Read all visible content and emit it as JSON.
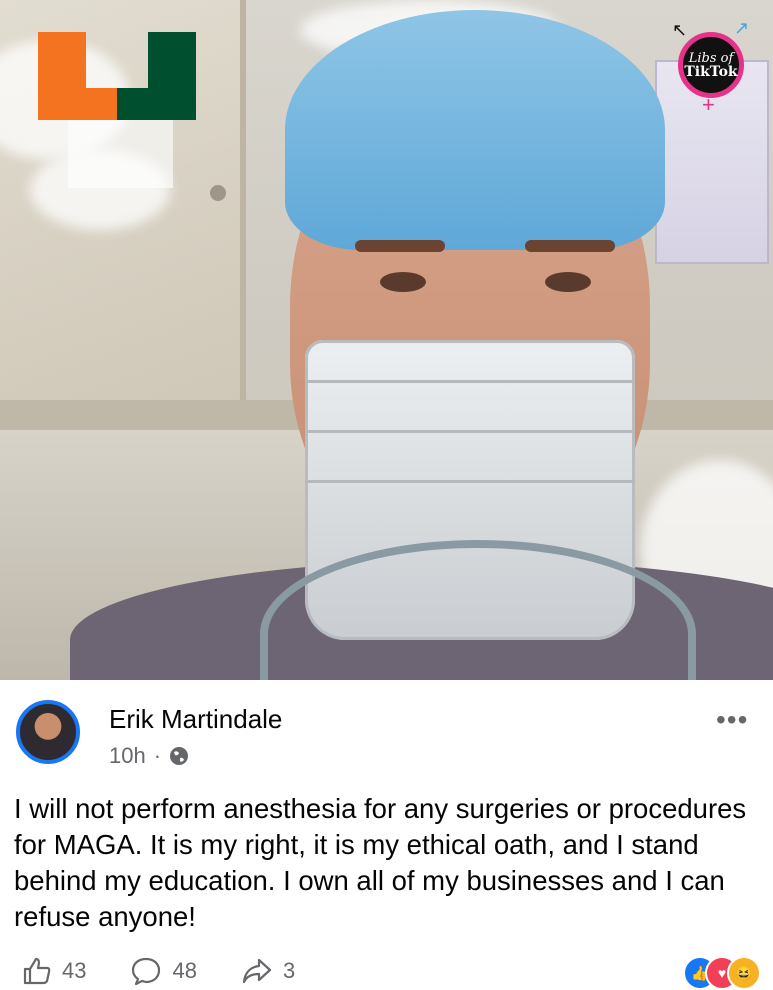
{
  "photo": {
    "overlay_logo_left": {
      "name": "university-u-logo",
      "colors": [
        "#f47321",
        "#005030"
      ]
    },
    "overlay_badge_right": {
      "line1": "Libs of",
      "line2": "TikTok",
      "accent": "#e6338a"
    }
  },
  "post": {
    "author": "Erik Martindale",
    "time": "10h",
    "separator": "·",
    "privacy_icon": "globe-icon",
    "more_icon": "•••",
    "text": "I will not perform anesthesia for any surgeries or procedures for MAGA. It is my right, it is my ethical oath, and I stand behind my education. I own all of my businesses and I can refuse anyone!",
    "actions": {
      "likes": "43",
      "comments": "48",
      "shares": "3"
    },
    "reactions": [
      "like-reaction",
      "love-reaction",
      "haha-reaction"
    ],
    "colors": {
      "accent": "#1877f2",
      "meta": "#65676b",
      "text": "#050505"
    }
  }
}
